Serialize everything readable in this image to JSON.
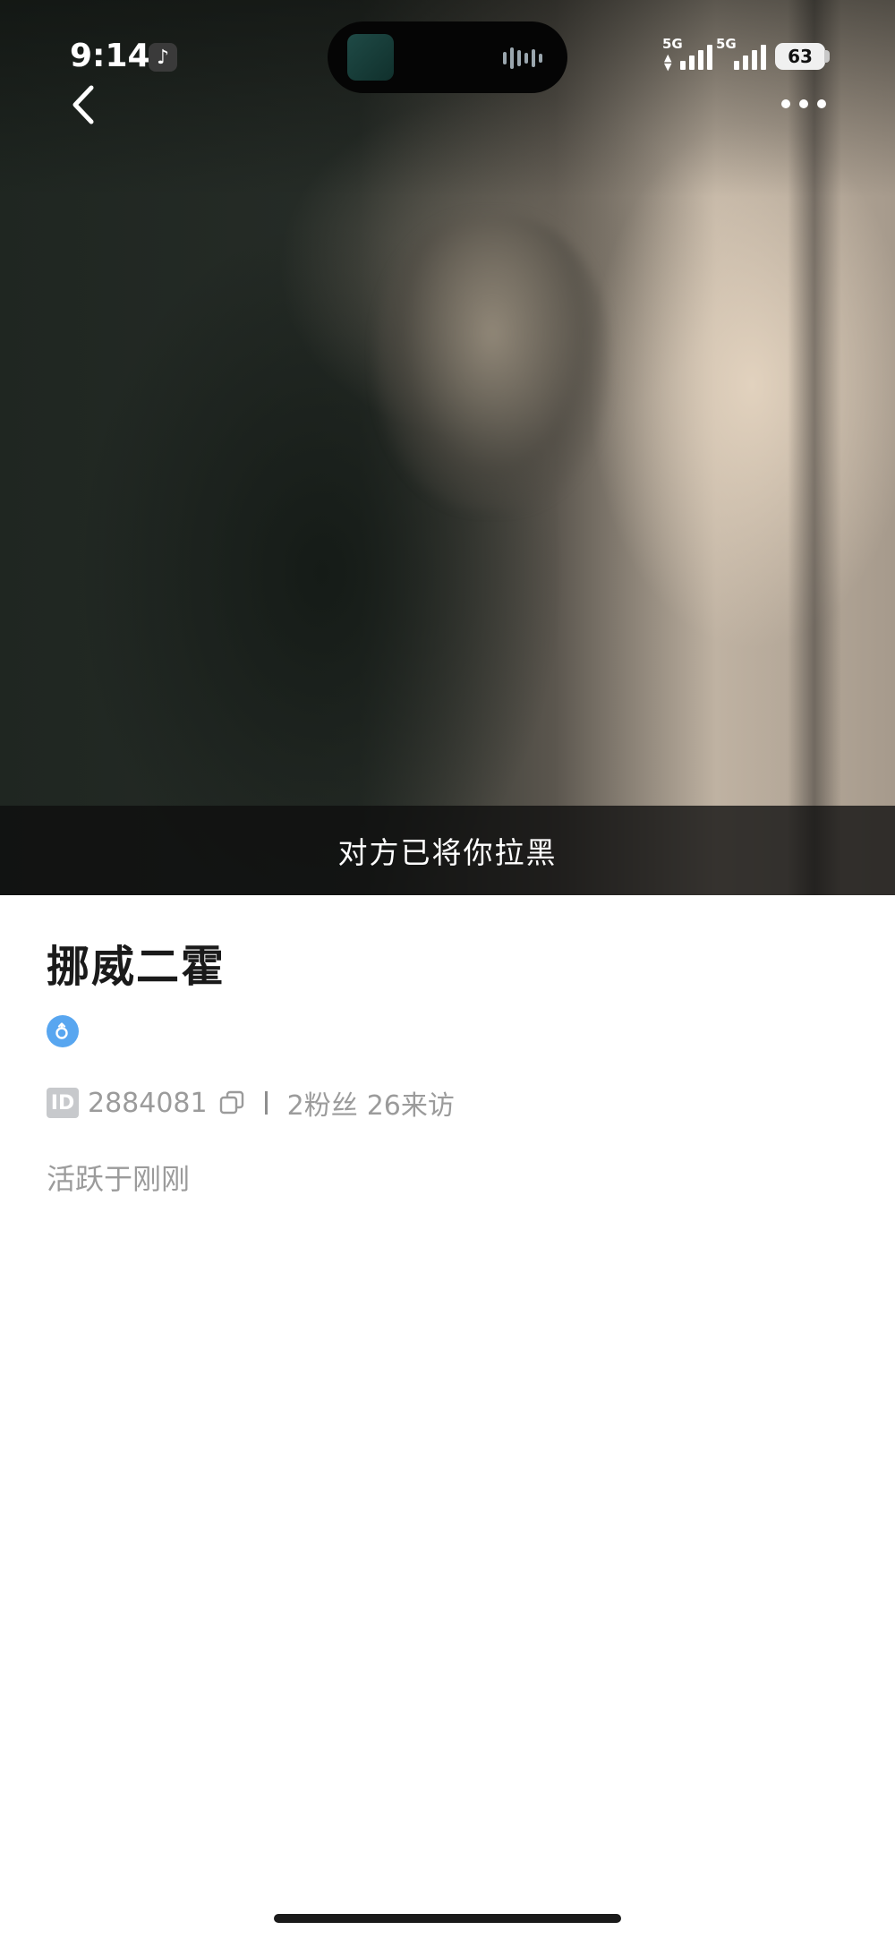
{
  "status_bar": {
    "time": "9:14",
    "app_icon": "tiktok-icon",
    "network_1": "5G",
    "network_2": "5G",
    "battery": "63"
  },
  "header": {
    "back_icon": "chevron-left-icon",
    "more_icon": "more-dots-icon"
  },
  "cover": {
    "blocked_notice": "对方已将你拉黑"
  },
  "profile": {
    "username": "挪威二霍",
    "gender_icon": "male-icon",
    "gender_color": "#58a6f0",
    "id_label": "ID",
    "id_value": "2884081",
    "fans": "2粉丝",
    "visits": "26来访",
    "active_status": "活跃于刚刚"
  }
}
